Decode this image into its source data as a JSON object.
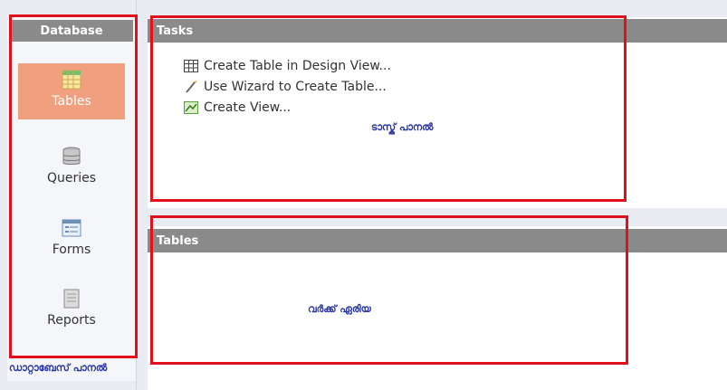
{
  "database_panel": {
    "title": "Database",
    "items": [
      {
        "label": "Tables",
        "icon": "table-icon",
        "selected": true
      },
      {
        "label": "Queries",
        "icon": "database-icon",
        "selected": false
      },
      {
        "label": "Forms",
        "icon": "form-icon",
        "selected": false
      },
      {
        "label": "Reports",
        "icon": "report-icon",
        "selected": false
      }
    ],
    "caption": "ഡാറ്റാബേസ് പാനൽ"
  },
  "tasks_panel": {
    "title": "Tasks",
    "items": [
      {
        "label": "Create Table in Design View...",
        "icon": "grid-icon"
      },
      {
        "label": "Use Wizard to Create Table...",
        "icon": "wand-icon"
      },
      {
        "label": "Create View...",
        "icon": "view-icon"
      }
    ],
    "caption": "ടാസ്ക് പാനൽ"
  },
  "tables_panel": {
    "title": "Tables",
    "caption": "വർക്ക് ഏരിയ"
  },
  "colors": {
    "header_bg": "#8a8a8a",
    "selected_bg": "#f0a07e",
    "highlight_border": "#e1101a",
    "caption_text": "#2a36a8"
  }
}
